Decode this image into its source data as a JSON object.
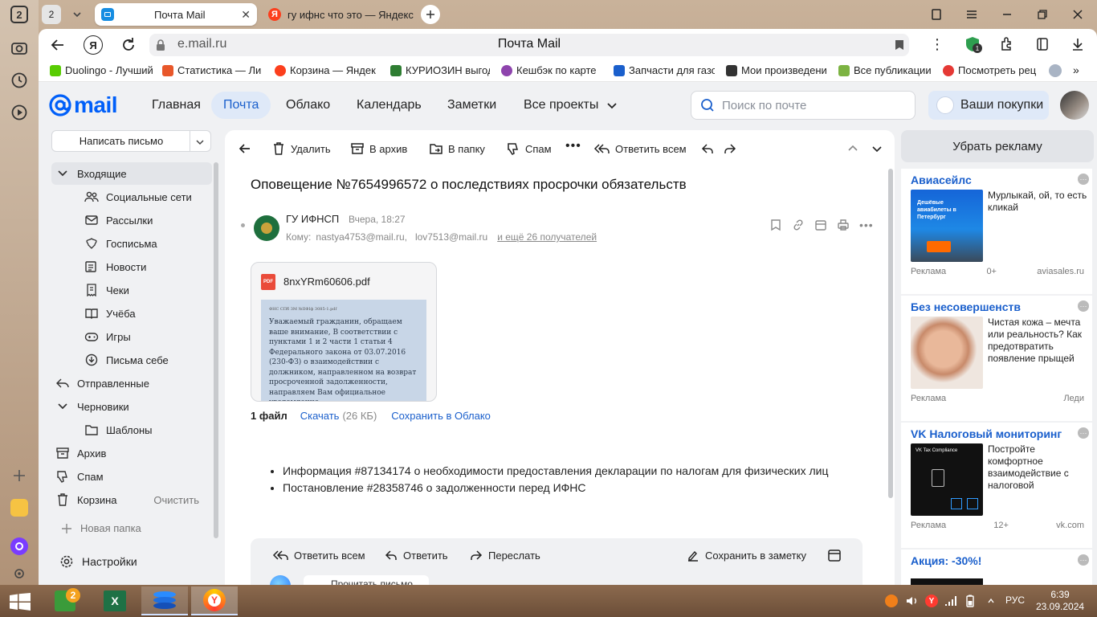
{
  "browser": {
    "tab_count": "2",
    "tabs": [
      {
        "title": "Почта Mail",
        "active": true
      },
      {
        "title": "гу ифнс что это — Яндекс"
      }
    ],
    "address": {
      "domain": "e.mail.ru",
      "page_title": "Почта Mail"
    },
    "ext_badge": "1",
    "bookmarks": [
      {
        "label": "Duolingo - Лучший",
        "color": "#58cc02"
      },
      {
        "label": "Статистика — Ли",
        "color": "#e8572a"
      },
      {
        "label": "Корзина — Яндекс",
        "color": "#fc3f1d"
      },
      {
        "label": "КУРИОЗИН выгод",
        "color": "#2e7d32"
      },
      {
        "label": "Кешбэк по карте",
        "color": "#8e44ad"
      },
      {
        "label": "Запчасти для газо",
        "color": "#1a5fcc"
      },
      {
        "label": "Мои произведени",
        "color": "#333333"
      },
      {
        "label": "Все публикации",
        "color": "#7cb342"
      },
      {
        "label": "Посмотреть рец",
        "color": "#e53935"
      }
    ]
  },
  "mail": {
    "logo": "mail",
    "nav": [
      "Главная",
      "Почта",
      "Облако",
      "Календарь",
      "Заметки",
      "Все проекты"
    ],
    "active_nav": "Почта",
    "search_placeholder": "Поиск по почте",
    "purchases": "Ваши покупки",
    "compose": "Написать письмо",
    "folders": [
      {
        "label": "Входящие",
        "level": 0,
        "icon": "chevron-down-icon",
        "active": true
      },
      {
        "label": "Социальные сети",
        "level": 1,
        "icon": "people-icon"
      },
      {
        "label": "Рассылки",
        "level": 1,
        "icon": "newsletter-icon"
      },
      {
        "label": "Госписьма",
        "level": 1,
        "icon": "emblem-icon"
      },
      {
        "label": "Новости",
        "level": 1,
        "icon": "news-icon"
      },
      {
        "label": "Чеки",
        "level": 1,
        "icon": "receipt-icon"
      },
      {
        "label": "Учёба",
        "level": 1,
        "icon": "book-icon"
      },
      {
        "label": "Игры",
        "level": 1,
        "icon": "gamepad-icon"
      },
      {
        "label": "Письма себе",
        "level": 1,
        "icon": "self-mail-icon"
      },
      {
        "label": "Отправленные",
        "level": 0,
        "icon": "sent-icon"
      },
      {
        "label": "Черновики",
        "level": 0,
        "icon": "chevron-down-icon"
      },
      {
        "label": "Шаблоны",
        "level": 1,
        "icon": "folder-icon"
      },
      {
        "label": "Архив",
        "level": 0,
        "icon": "archive-icon"
      },
      {
        "label": "Спам",
        "level": 0,
        "icon": "spam-icon"
      },
      {
        "label": "Корзина",
        "level": 0,
        "icon": "trash-icon",
        "action": "Очистить"
      }
    ],
    "new_folder": "Новая папка",
    "settings": "Настройки",
    "toolbar": {
      "delete": "Удалить",
      "archive": "В архив",
      "move": "В папку",
      "spam": "Спам",
      "reply_all": "Ответить всем"
    },
    "letter": {
      "subject": "Оповещение №7654996572 о последствиях просрочки обязательств",
      "sender": "ГУ ИФНСП",
      "date": "Вчера, 18:27",
      "to_label": "Кому:",
      "recipients": [
        "nastya4753@mail.ru,",
        "lov7513@mail.ru"
      ],
      "more_recipients": "и ещё 26 получателей",
      "attachment": {
        "filename": "8nxYRm60606.pdf",
        "preview_header": "ФНС СПб 3М №IIФIф 3085-1.pdf",
        "preview_text": "Уважаемый гражданин, обращаем ваше внимание, В соответствии с пунктами 1 и 2 части 1 статьи 4 Федерального закона от 03.07.2016 (230-ФЗ) о взаимодействии с должником, направленном на возврат просроченной задолженности, направляем Вам официальное уведомление."
      },
      "files_count": "1 файл",
      "download": "Скачать",
      "size": "(26 КБ)",
      "save_cloud": "Сохранить в Облако",
      "body_items": [
        "Информация #87134174 о необходимости предоставления декларации по налогам для физических лиц",
        "Постановление #28358746 о задолженности перед ИФНС"
      ]
    },
    "bottom_bar": {
      "reply_all": "Ответить всем",
      "reply": "Ответить",
      "forward": "Переслать",
      "save_note": "Сохранить в заметку",
      "peek_text": "Прочитать письмо"
    },
    "remove_ads": "Убрать рекламу",
    "ads": [
      {
        "title": "Авиасейлс",
        "text": "Мурлыкай, ой, то есть кликай",
        "label": "Реклама",
        "meta": "0+",
        "source": "aviasales.ru",
        "img_caption": "Дешёвые авиабилеты в Петербург"
      },
      {
        "title": "Без несовершенств",
        "text": "Чистая кожа – мечта или реальность? Как предотвратить появление прыщей",
        "label": "Реклама",
        "meta": "",
        "source": "Леди"
      },
      {
        "title": "VK Налоговый мониторинг",
        "text": "Постройте комфортное взаимодействие с налоговой",
        "label": "Реклама",
        "meta": "12+",
        "source": "vk.com",
        "img_caption": "VK Tax Compliance"
      },
      {
        "title": "Акция: -30%!"
      }
    ]
  },
  "taskbar": {
    "lang": "РУС",
    "time": "6:39",
    "date": "23.09.2024",
    "notif_badge": "2"
  }
}
